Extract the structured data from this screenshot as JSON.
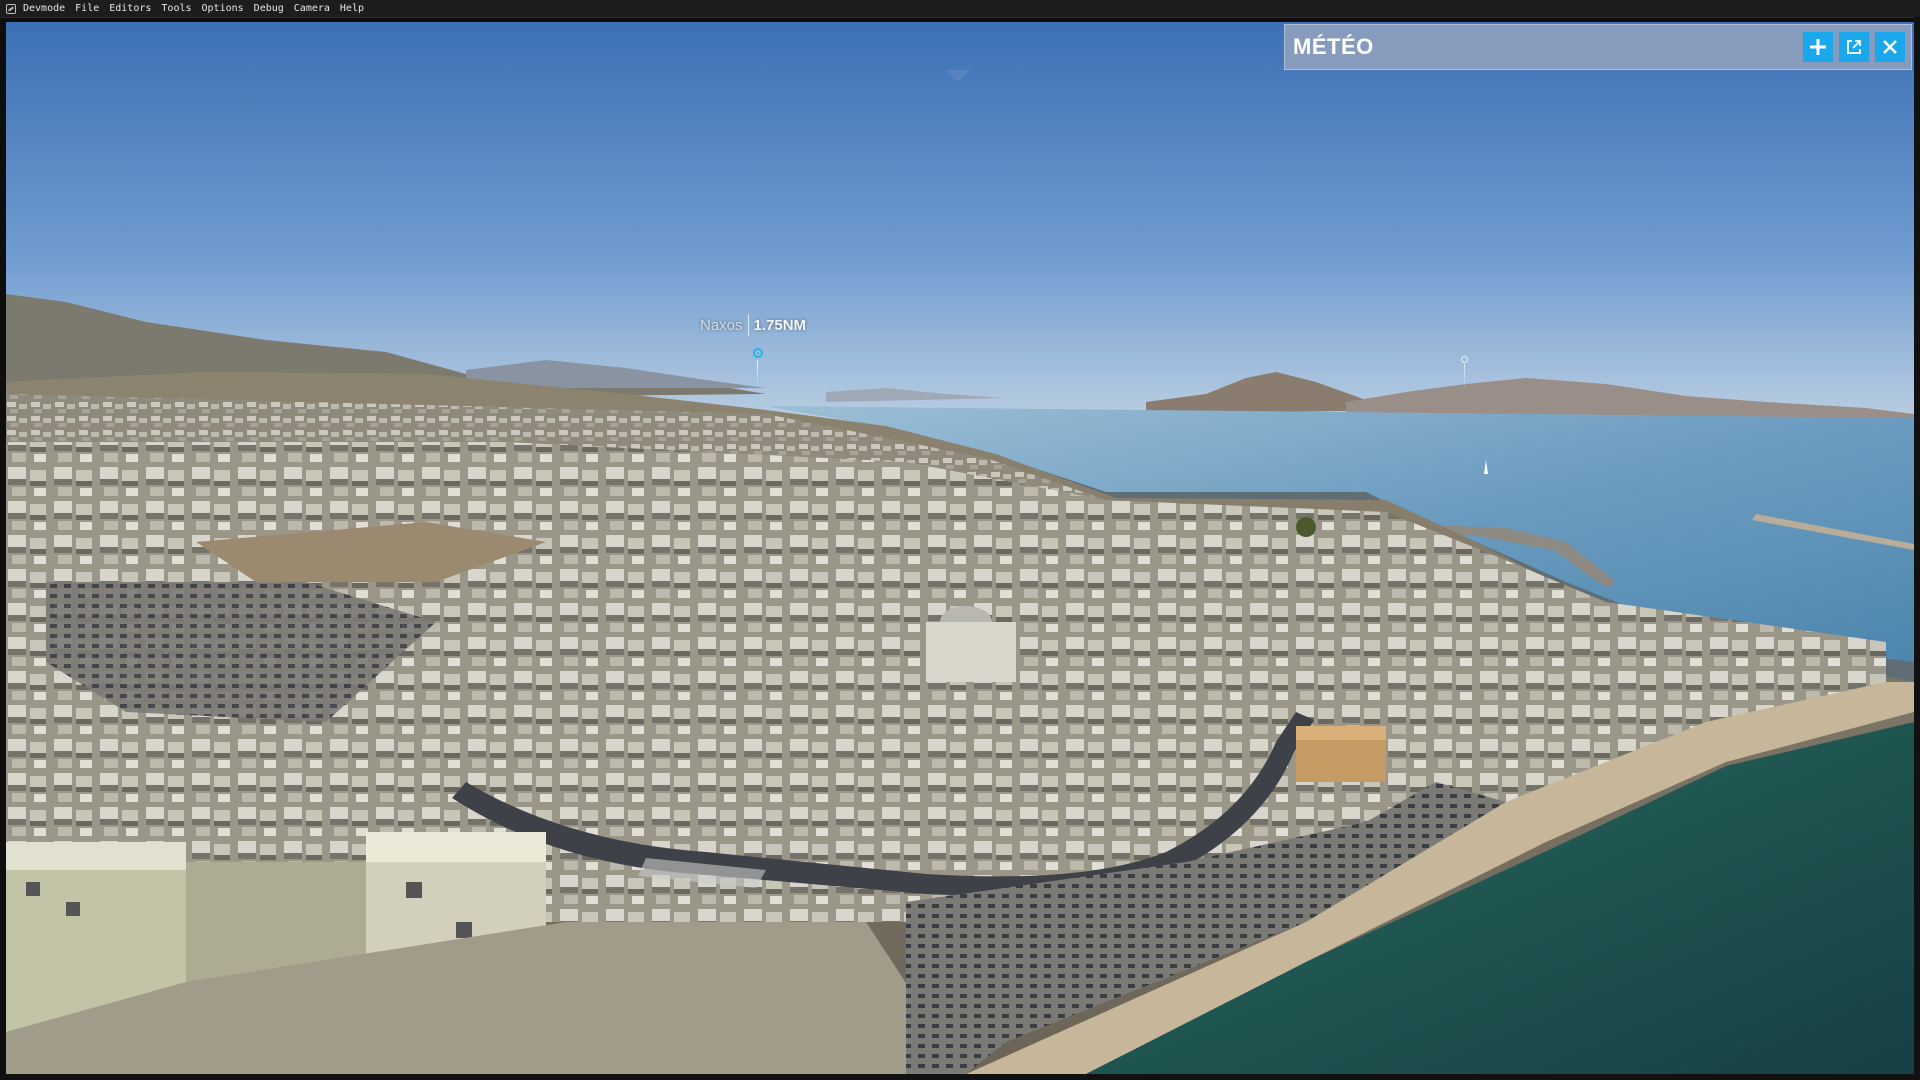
{
  "menubar": {
    "items": [
      "Devmode",
      "File",
      "Editors",
      "Tools",
      "Options",
      "Debug",
      "Camera",
      "Help"
    ]
  },
  "viewport": {
    "poi": {
      "name": "Naxos",
      "distance": "1.75NM"
    }
  },
  "meteo_panel": {
    "title": "MÉTÉO",
    "buttons": {
      "add_icon": "plus-icon",
      "detach_icon": "external-window-icon",
      "close_icon": "close-icon"
    },
    "accent_color": "#1aa7ec"
  }
}
